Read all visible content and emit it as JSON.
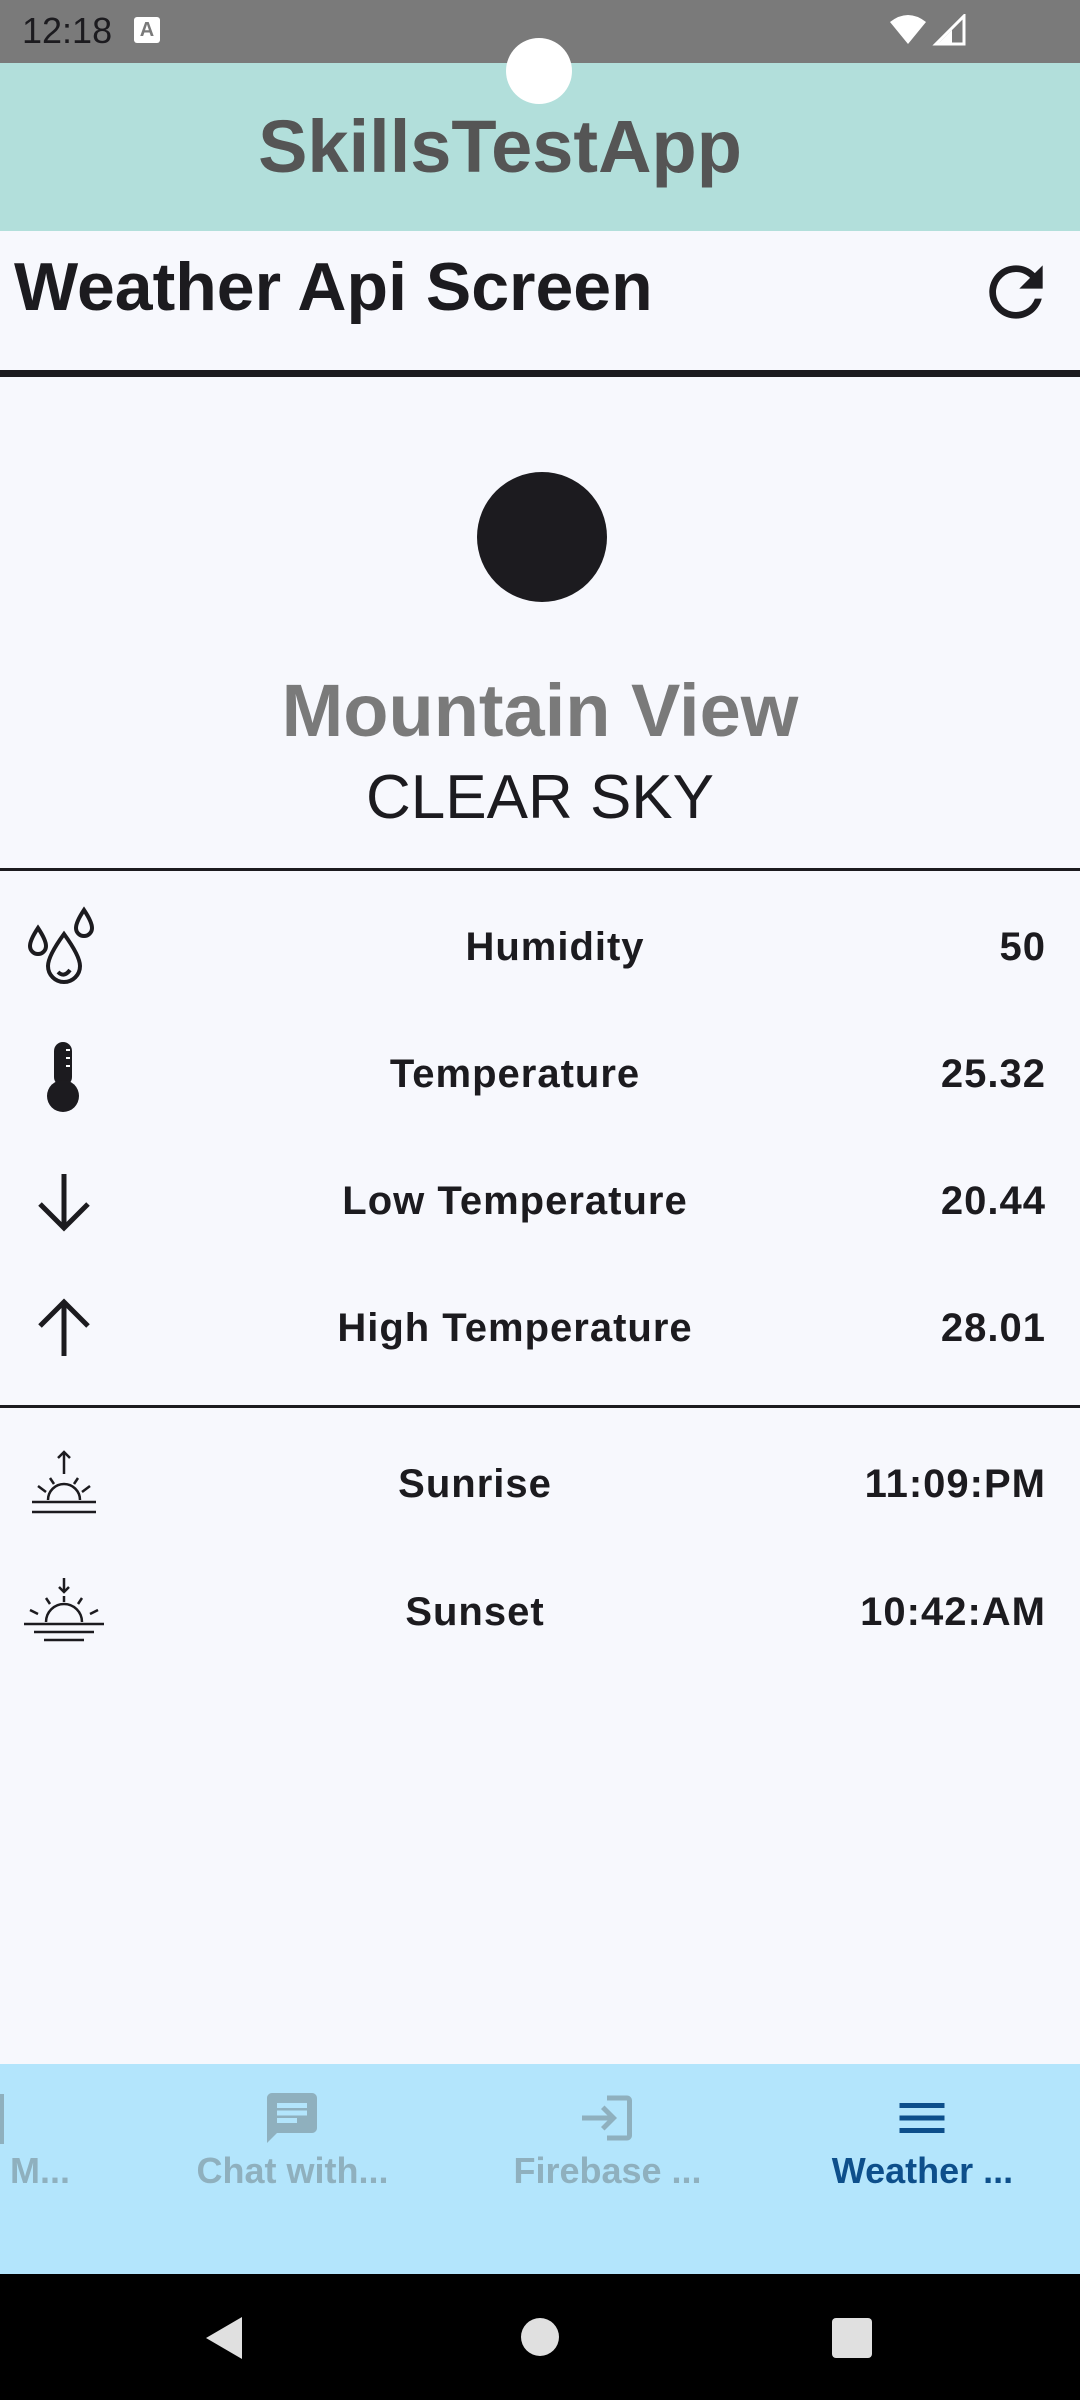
{
  "status_bar": {
    "time": "12:18",
    "notification_glyph": "A"
  },
  "app_bar": {
    "title": "SkillsTestApp"
  },
  "screen": {
    "title": "Weather Api Screen",
    "refresh_icon": "refresh-icon"
  },
  "weather": {
    "city": "Mountain View",
    "condition": "CLEAR SKY"
  },
  "stats": [
    {
      "icon": "water-drops-icon",
      "label": "Humidity",
      "value": "50"
    },
    {
      "icon": "thermometer-icon",
      "label": "Temperature",
      "value": "25.32"
    },
    {
      "icon": "arrow-down-icon",
      "label": "Low Temperature",
      "value": "20.44"
    },
    {
      "icon": "arrow-up-icon",
      "label": "High Temperature",
      "value": "28.01"
    }
  ],
  "sun": [
    {
      "icon": "sunrise-icon",
      "label": "Sunrise",
      "value": "11:09:PM"
    },
    {
      "icon": "sunset-icon",
      "label": "Sunset",
      "value": "10:42:AM"
    }
  ],
  "bottom_nav": {
    "items": [
      {
        "label": "M...",
        "icon": "partial-icon",
        "active": false
      },
      {
        "label": "Chat with...",
        "icon": "chat-icon",
        "active": false
      },
      {
        "label": "Firebase ...",
        "icon": "login-icon",
        "active": false
      },
      {
        "label": "Weather ...",
        "icon": "menu-icon",
        "active": true
      }
    ]
  },
  "colors": {
    "app_bar": "#b2dfdb",
    "bottom_nav": "#b3e5fc",
    "active_nav": "#0d4f8b",
    "inactive_nav": "#8fb0be"
  }
}
